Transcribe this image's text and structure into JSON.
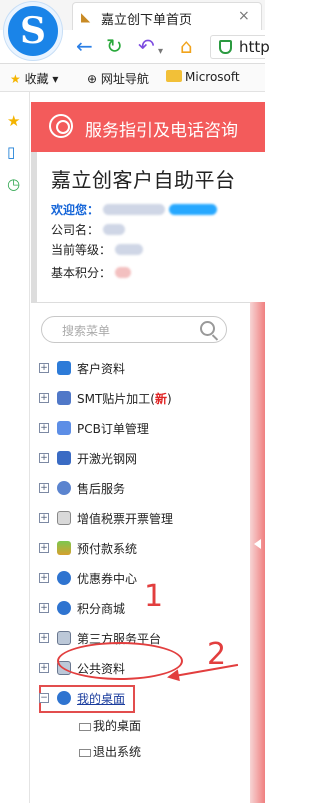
{
  "browser": {
    "tab_title": "嘉立创下单首页",
    "tab_close": "×",
    "address_text": "http"
  },
  "bookmarks": [
    {
      "label": "收藏"
    },
    {
      "label": "网址导航"
    },
    {
      "label": "Microsoft"
    }
  ],
  "banner": {
    "title": "服务指引及电话咨询"
  },
  "account": {
    "title": "嘉立创客户自助平台",
    "welcome_label": "欢迎您：",
    "company_label": "公司名：",
    "level_label": "当前等级：",
    "points_label": "基本积分："
  },
  "search": {
    "placeholder": "搜索菜单"
  },
  "menu": {
    "items": [
      {
        "label": "客户资料",
        "icon": "customer-icon"
      },
      {
        "label": "SMT贴片加工(",
        "new": "新",
        "close": ")",
        "icon": "smt-icon"
      },
      {
        "label": "PCB订单管理",
        "icon": "pcb-icon"
      },
      {
        "label": "开激光钢网",
        "icon": "laser-stencil-icon"
      },
      {
        "label": "售后服务",
        "icon": "after-sales-icon"
      },
      {
        "label": "增值税票开票管理",
        "icon": "invoice-icon"
      },
      {
        "label": "预付款系统",
        "icon": "prepaid-icon"
      },
      {
        "label": "优惠券中心",
        "icon": "coupon-icon"
      },
      {
        "label": "积分商城",
        "icon": "points-mall-icon"
      },
      {
        "label": "第三方服务平台",
        "icon": "third-party-icon"
      },
      {
        "label": "公共资料",
        "icon": "public-data-icon"
      },
      {
        "label": "我的桌面",
        "icon": "desktop-icon"
      }
    ],
    "sub_items": [
      {
        "label": "我的桌面"
      },
      {
        "label": "退出系统"
      }
    ]
  },
  "annotations": {
    "step1": "1",
    "step2": "2"
  },
  "colors": {
    "banner": "#f35b5b",
    "annotation_red": "#e23e3e",
    "welcome_blue": "#1565d8"
  }
}
